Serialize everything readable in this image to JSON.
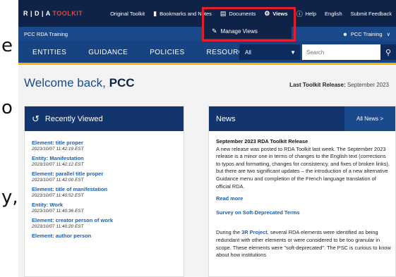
{
  "slide": {
    "chars": [
      "e",
      "o",
      "y,"
    ]
  },
  "topbar": {
    "brand_prefix": "R | D | A",
    "brand_suffix": "TOOLKIT",
    "links": {
      "original_toolkit": "Original Toolkit",
      "bookmarks": "Bookmarks and Notes",
      "documents": "Documents",
      "views": "Views",
      "help": "Help",
      "language": "English",
      "feedback": "Submit Feedback"
    }
  },
  "views_menu": {
    "manage_views": "Manage Views"
  },
  "titlebar": {
    "title": "PCC RDA Training",
    "user": "PCC Training"
  },
  "nav": {
    "items": [
      "ENTITIES",
      "GUIDANCE",
      "POLICIES",
      "RESOURCES"
    ],
    "scope_value": "All",
    "search_placeholder": "Search"
  },
  "welcome": {
    "prefix": "Welcome back, ",
    "name": "PCC"
  },
  "release": {
    "label": "Last Toolkit Release:",
    "value": "September 2023"
  },
  "recently_viewed": {
    "title": "Recently Viewed",
    "items": [
      {
        "label": "Element: title proper",
        "time": "2023/10/07 11:42:19 EST"
      },
      {
        "label": "Entity: Manifestation",
        "time": "2023/10/07 11:42:12 EST"
      },
      {
        "label": "Element: parallel title proper",
        "time": "2023/10/07 11:42:00 EST"
      },
      {
        "label": "Element: title of manifestation",
        "time": "2023/10/07 11:40:52 EST"
      },
      {
        "label": "Entity: Work",
        "time": "2023/10/07 11:40:36 EST"
      },
      {
        "label": "Element: creator person of work",
        "time": "2023/10/07 11:40:20 EST"
      },
      {
        "label": "Element: author person",
        "time": ""
      }
    ]
  },
  "news": {
    "title": "News",
    "all_news": "All News >",
    "item1_title": "September 2023 RDA Toolkit Release",
    "item1_body": "A new release was posted to RDA Toolkit last week. The September 2023 release is a minor one in terms of changes to the English text (corrections to typos and formatting, changes for consistency, and fixes of broken links), but there are two significant updates – the introduction of a new alternative Guidance menu and completion of the French language translation of official RDA.",
    "read_more": "Read more",
    "item2_title": "Survey on Soft-Deprecated Terms",
    "item2_body_pre": "During the ",
    "item2_link": "3R Project",
    "item2_body_post": ", several RDA elements were identified as being redundant with other elements or were considered to be too granular in scope. These elements were \"soft-deprecated\". The PSC is curious to know about how institutions"
  },
  "colors": {
    "accent_red": "#e01e2d",
    "yellow": "#f5b800",
    "navy": "#0e2347"
  }
}
